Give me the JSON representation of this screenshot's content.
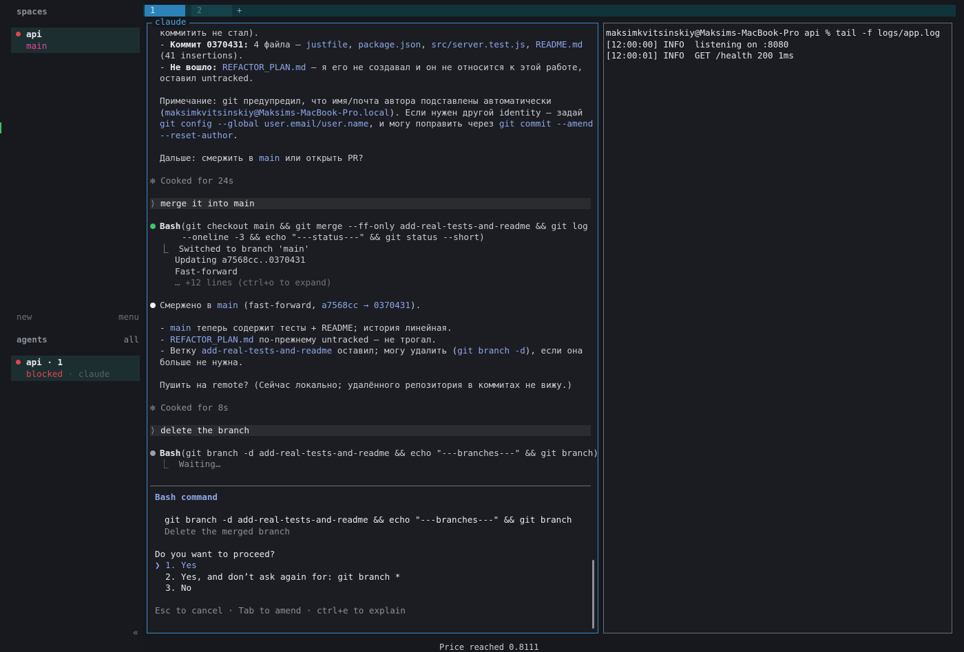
{
  "tabs": [
    {
      "label": "1",
      "active": true
    },
    {
      "label": "2",
      "active": false
    },
    {
      "label": "+"
    }
  ],
  "sidebar": {
    "spaces_heading": "spaces",
    "space": {
      "name": "api",
      "branch": "main"
    },
    "new_label": "new",
    "menu_label": "menu",
    "agents_heading": "agents",
    "all_label": "all",
    "agent": {
      "name": "api · 1",
      "status": "blocked",
      "tool": "· claude"
    },
    "collapse_glyph": "«"
  },
  "pane": {
    "title": "claude",
    "lines": {
      "l1": "коммитить не стал).",
      "l2a": "- ",
      "l2b": "Коммит",
      "l2c": " 0370431",
      "l2d": ":",
      "l2e": " 4 файла — ",
      "l2f": "justfile",
      "l2g": ", ",
      "l2h": "package.json",
      "l2i": ", ",
      "l2j": "src/server.test.js",
      "l2k": ", ",
      "l2l": "README.md",
      "l3": "(41 insertions).",
      "l4a": "- ",
      "l4b": "Не вошло:",
      "l4c": " REFACTOR_PLAN.md",
      "l4d": " — я его не создавал и он не относится к этой работе,",
      "l5": "оставил untracked.",
      "l6": "Примечание: git предупредил, что имя/почта автора подставлены автоматически",
      "l7a": "(",
      "l7b": "maksimkvitsinskiy@Maksims-MacBook-Pro.local",
      "l7c": "). Если нужен другой identity — задай",
      "l8a": "git config --global user.email/user.name",
      "l8b": ", и могу поправить через ",
      "l8c": "git commit --amend",
      "l9a": "--reset-author",
      "l9b": ".",
      "l10a": "Дальше: смержить в ",
      "l10b": "main",
      "l10c": " или открыть PR?",
      "cooked1": "✻ Cooked for 24s",
      "user1": "merge it into main",
      "bash1a": "Bash",
      "bash1b": "(git checkout main && git merge --ff-only add-real-tests-and-readme && git log",
      "bash1c": "--oneline -3 && echo \"---status---\" && git status --short)",
      "out1": "⎿  Switched to branch 'main'",
      "out2": "Updating a7568cc..0370431",
      "out3": "Fast-forward",
      "out4": "… +12 lines (ctrl+o to expand)",
      "merged_a": "Смержено в ",
      "merged_b": "main",
      "merged_c": " (fast-forward, ",
      "merged_d": "a7568cc → 0370431",
      "merged_e": ").",
      "p1a": "- ",
      "p1b": "main",
      "p1c": " теперь содержит тесты + README; история линейная.",
      "p2a": "- ",
      "p2b": "REFACTOR_PLAN.md",
      "p2c": " по-прежнему untracked — не трогал.",
      "p3a": "- Ветку ",
      "p3b": "add-real-tests-and-readme",
      "p3c": " оставил; могу удалить (",
      "p3d": "git branch -d",
      "p3e": "), если она",
      "p3f": "больше не нужна.",
      "push": "Пушить на remote? (Сейчас локально; удалённого репозитория в коммитах не вижу.)",
      "cooked2": "✻ Cooked for 8s",
      "user2": "delete the branch",
      "bash2a": "Bash",
      "bash2b": "(git branch -d add-real-tests-and-readme && echo \"---branches---\" && git branch)",
      "waiting": "⎿  Waiting…"
    },
    "prompt": {
      "title": "Bash command",
      "command": "git branch -d add-real-tests-and-readme && echo \"---branches---\" && git branch",
      "description": "Delete the merged branch",
      "question": "Do you want to proceed?",
      "options": [
        "❯ 1. Yes",
        "  2. Yes, and don’t ask again for: git branch *",
        "  3. No"
      ],
      "footer": "Esc to cancel · Tab to amend · ctrl+e to explain"
    }
  },
  "terminal": {
    "lines": [
      "maksimkvitsinskiy@Maksims-MacBook-Pro api % tail -f logs/app.log",
      "[12:00:00] INFO  listening on :8080",
      "[12:00:01] INFO  GET /health 200 1ms"
    ]
  },
  "statusbar": "Price reached 0.8111"
}
